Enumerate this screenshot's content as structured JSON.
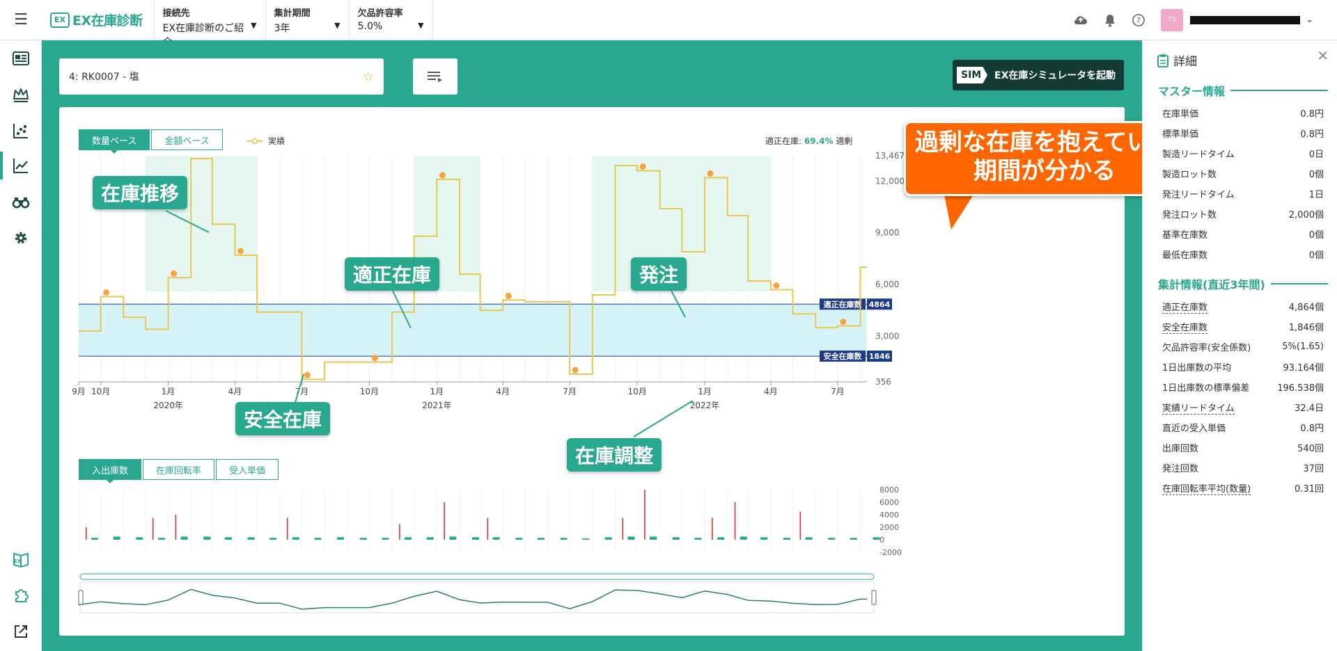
{
  "header": {
    "logo_mark": "EX",
    "logo_text": "EX在庫診断",
    "connection": {
      "label": "接続先",
      "value": "EX在庫診断のご紹介"
    },
    "period": {
      "label": "集計期間",
      "value": "3年"
    },
    "stockout": {
      "label": "欠品許容率",
      "value": "5.0%"
    },
    "avatar_initials": "TS"
  },
  "item_search": {
    "value": "4: RK0007 - 塩"
  },
  "sim_button": {
    "badge": "SIM",
    "label": "EX在庫シミュレータを起動"
  },
  "chart_controls": {
    "base_tabs": [
      "数量ベース",
      "金額ベース"
    ],
    "legend_label": "実績",
    "stats_label": "適正在庫:",
    "stats_value": "69.4%",
    "stats_suffix": "適剰"
  },
  "bottom_tabs": [
    "入出庫数",
    "在庫回転率",
    "受入単価"
  ],
  "annotations": {
    "stock_trend": "在庫推移",
    "proper_stock": "適正在庫",
    "order": "発注",
    "safety_stock": "安全在庫",
    "adjustment": "在庫調整",
    "big_1": "過剰な在庫を抱えている",
    "big_2": "期間が分かる"
  },
  "chart_data": {
    "type": "line",
    "x": [
      "2019-09-01",
      "2019-10-01",
      "2019-11-01",
      "2019-12-01",
      "2020-01-01",
      "2020-02-01",
      "2020-03-01",
      "2020-04-01",
      "2020-05-01",
      "2020-06-01",
      "2020-07-01",
      "2020-08-01",
      "2020-09-01",
      "2020-10-01",
      "2020-11-01",
      "2020-12-01",
      "2021-01-01",
      "2021-02-01",
      "2021-03-01",
      "2021-04-01",
      "2021-05-01",
      "2021-06-01",
      "2021-07-01",
      "2021-08-01",
      "2021-09-01",
      "2021-10-01",
      "2021-11-01",
      "2021-12-01",
      "2022-01-01",
      "2022-02-01",
      "2022-03-01",
      "2022-04-01",
      "2022-05-01",
      "2022-06-01",
      "2022-07-01",
      "2022-08-01"
    ],
    "series": [
      {
        "name": "実績",
        "values": [
          3300,
          5300,
          4100,
          3400,
          6400,
          13300,
          9500,
          7700,
          4400,
          4400,
          500,
          1500,
          1500,
          1500,
          4400,
          8800,
          12100,
          6600,
          4500,
          5100,
          5000,
          5000,
          800,
          5400,
          12900,
          12600,
          10400,
          7900,
          12200,
          10000,
          6200,
          5700,
          4300,
          3500,
          3600,
          7000
        ]
      }
    ],
    "reference_lines": [
      {
        "label": "適正在庫数",
        "value": 4864,
        "color": "#1d3a8a"
      },
      {
        "label": "安全在庫数",
        "value": 1846,
        "color": "#1d3a8a"
      }
    ],
    "y_ticks": [
      356,
      3000,
      6000,
      9000,
      12000,
      13467
    ],
    "y_tick_labels": [
      "356",
      "3,000",
      "6,000",
      "9,000",
      "12,000",
      "13,467"
    ],
    "ylim": [
      356,
      13467
    ],
    "x_tick_labels": [
      {
        "label": "9月",
        "date": "2019-09-01"
      },
      {
        "label": "10月",
        "date": "2019-10-01"
      },
      {
        "label": "1月",
        "date": "2020-01-01"
      },
      {
        "label": "4月",
        "date": "2020-04-01"
      },
      {
        "label": "7月",
        "date": "2020-07-01"
      },
      {
        "label": "10月",
        "date": "2020-10-01"
      },
      {
        "label": "1月",
        "date": "2021-01-01"
      },
      {
        "label": "4月",
        "date": "2021-04-01"
      },
      {
        "label": "7月",
        "date": "2021-07-01"
      },
      {
        "label": "10月",
        "date": "2021-10-01"
      },
      {
        "label": "1月",
        "date": "2022-01-01"
      },
      {
        "label": "4月",
        "date": "2022-04-01"
      },
      {
        "label": "7月",
        "date": "2022-07-01"
      }
    ],
    "year_labels": [
      {
        "label": "2020年",
        "date": "2020-01-01"
      },
      {
        "label": "2021年",
        "date": "2021-01-01"
      },
      {
        "label": "2022年",
        "date": "2022-01-01"
      }
    ],
    "excess_periods": [
      [
        "2019-12-01",
        "2020-05-01"
      ],
      [
        "2020-12-01",
        "2021-03-01"
      ],
      [
        "2021-08-01",
        "2022-04-01"
      ]
    ],
    "bar_chart": {
      "type": "bar",
      "y_ticks": [
        8000,
        6000,
        4000,
        2000,
        0,
        -2000
      ],
      "y_tick_labels": [
        "8000",
        "6000",
        "4000",
        "2000",
        "0",
        "-2000"
      ],
      "ylim": [
        -2000,
        8000
      ],
      "series": [
        {
          "name": "出庫",
          "color": "#d33",
          "values": [
            2000,
            0,
            0,
            3500,
            4000,
            0,
            0,
            0,
            0,
            3500,
            0,
            0,
            0,
            0,
            2500,
            0,
            6000,
            0,
            3500,
            0,
            0,
            0,
            0,
            0,
            3500,
            8000,
            0,
            0,
            3500,
            6000,
            0,
            0,
            4500,
            0,
            0,
            0
          ]
        },
        {
          "name": "入庫",
          "color": "#2aa88f",
          "values": [
            300,
            500,
            400,
            300,
            500,
            500,
            400,
            400,
            300,
            400,
            300,
            400,
            300,
            300,
            400,
            400,
            500,
            400,
            400,
            300,
            300,
            300,
            200,
            400,
            500,
            500,
            400,
            300,
            400,
            500,
            400,
            300,
            400,
            300,
            300,
            400
          ]
        }
      ]
    }
  },
  "detail_panel": {
    "title": "詳細",
    "master_title": "マスター情報",
    "master_rows": [
      {
        "k": "在庫単価",
        "v": "0.8円"
      },
      {
        "k": "標準単価",
        "v": "0.8円"
      },
      {
        "k": "製造リードタイム",
        "v": "0日"
      },
      {
        "k": "製造ロット数",
        "v": "0個"
      },
      {
        "k": "発注リードタイム",
        "v": "1日"
      },
      {
        "k": "発注ロット数",
        "v": "2,000個"
      },
      {
        "k": "基準在庫数",
        "v": "0個"
      },
      {
        "k": "最低在庫数",
        "v": "0個"
      }
    ],
    "summary_title": "集計情報(直近3年間)",
    "summary_rows": [
      {
        "k": "適正在庫数",
        "v": "4,864個",
        "dotted": true
      },
      {
        "k": "安全在庫数",
        "v": "1,846個",
        "dotted": true
      },
      {
        "k": "欠品許容率(安全係数)",
        "v": "5%(1.65)",
        "dotted": false
      },
      {
        "k": "1日出庫数の平均",
        "v": "93.164個",
        "dotted": false
      },
      {
        "k": "1日出庫数の標準偏差",
        "v": "196.538個",
        "dotted": false
      },
      {
        "k": "実績リードタイム",
        "v": "32.4日",
        "dotted": true
      },
      {
        "k": "直近の受入単価",
        "v": "0.8円",
        "dotted": false
      },
      {
        "k": "出庫回数",
        "v": "540回",
        "dotted": false
      },
      {
        "k": "発注回数",
        "v": "37回",
        "dotted": false
      },
      {
        "k": "在庫回転率平均(数量)",
        "v": "0.31回",
        "dotted": true
      }
    ]
  }
}
